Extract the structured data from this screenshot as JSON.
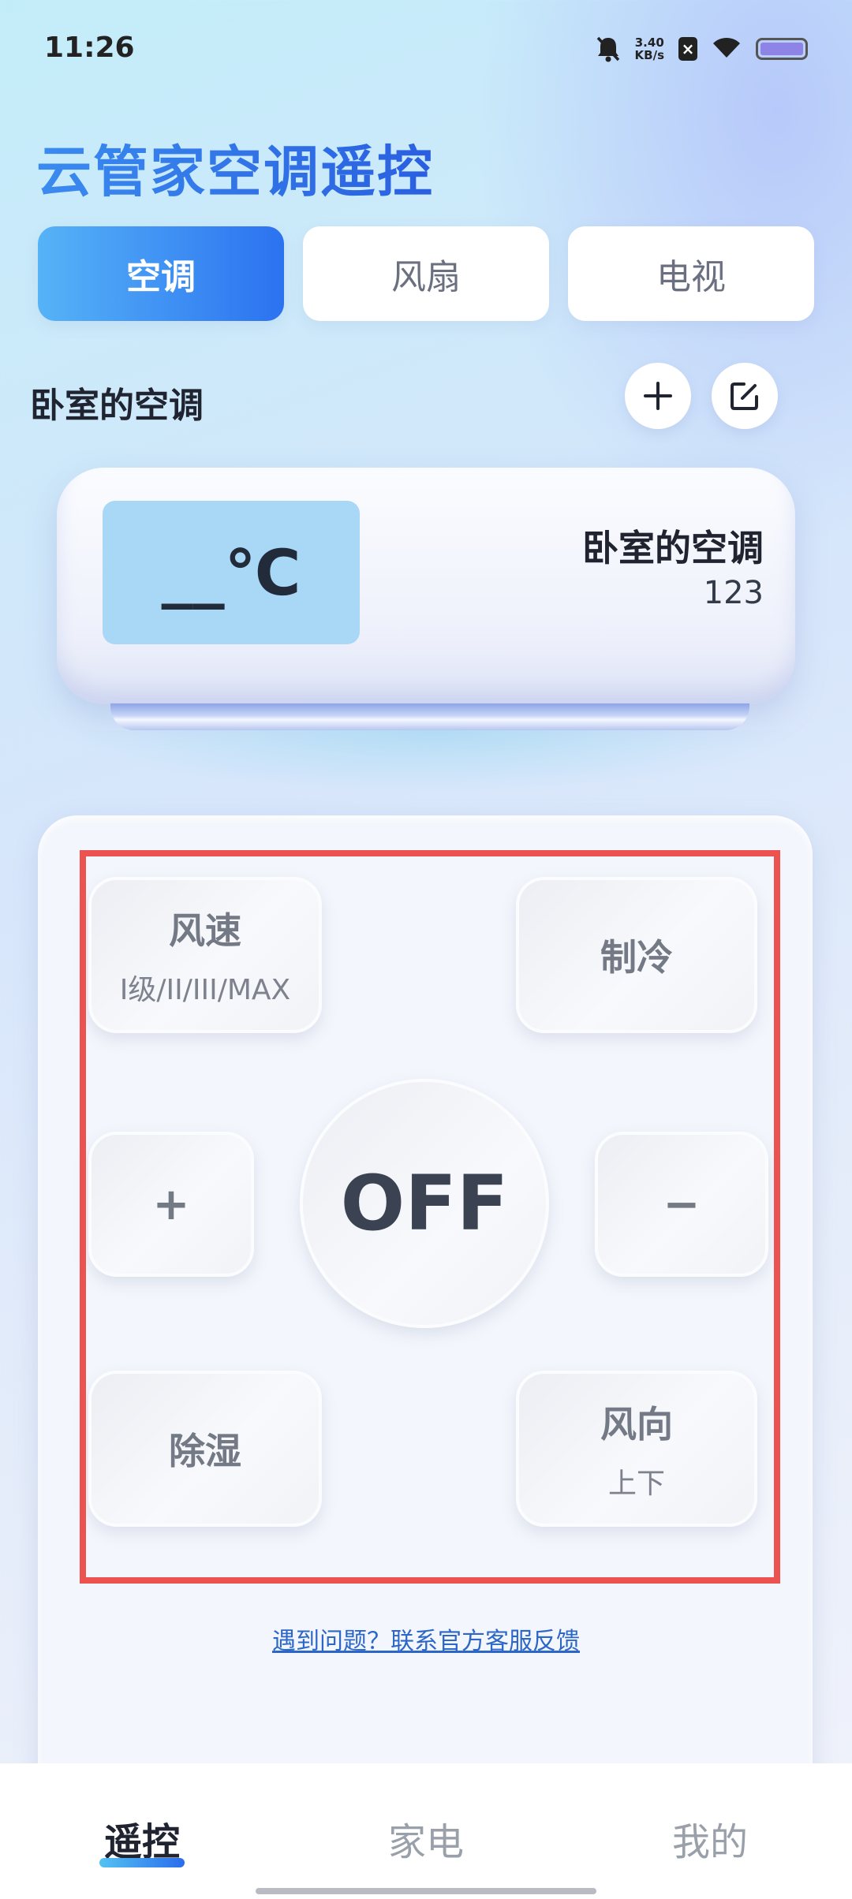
{
  "status_bar": {
    "time": "11:26",
    "speed_value": "3.40",
    "speed_unit": "KB/s",
    "icons": [
      "bell-muted-icon",
      "notification-x-icon",
      "wifi-icon",
      "battery-icon"
    ]
  },
  "app": {
    "title": "云管家空调遥控"
  },
  "tabs": [
    {
      "label": "空调",
      "active": true
    },
    {
      "label": "风扇",
      "active": false
    },
    {
      "label": "电视",
      "active": false
    }
  ],
  "device": {
    "name": "卧室的空调",
    "add_icon": "plus-icon",
    "edit_icon": "edit-icon"
  },
  "ac_unit": {
    "display": "__℃",
    "name": "卧室的空调",
    "code": "123"
  },
  "remote": {
    "speed": {
      "label": "风速",
      "sub": "I级/II/III/MAX"
    },
    "mode": {
      "label": "制冷"
    },
    "temp_up": {
      "label": "+"
    },
    "power": {
      "label": "OFF"
    },
    "temp_down": {
      "label": "−"
    },
    "dehumidify": {
      "label": "除湿"
    },
    "direction": {
      "label": "风向",
      "sub": "上下"
    }
  },
  "feedback_link": "遇到问题？联系官方客服反馈",
  "bottom_nav": [
    {
      "label": "遥控",
      "active": true
    },
    {
      "label": "家电",
      "active": false
    },
    {
      "label": "我的",
      "active": false
    }
  ],
  "colors": {
    "accent_start": "#56b3f7",
    "accent_end": "#2b72f0",
    "highlight_border": "#ec5350",
    "link": "#2c67c7"
  }
}
